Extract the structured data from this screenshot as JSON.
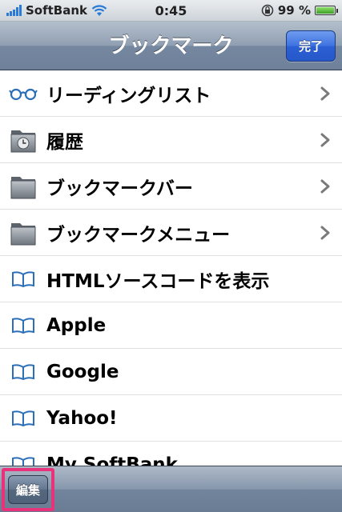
{
  "status_bar": {
    "carrier": "SoftBank",
    "time": "0:45",
    "battery_percent": "99 %",
    "battery_level": 0.99,
    "signal_icon": "signal-bars-icon",
    "wifi_icon": "wifi-icon",
    "lock_icon": "rotation-lock-icon"
  },
  "nav": {
    "title": "ブックマーク",
    "done_label": "完了"
  },
  "bookmarks": [
    {
      "label": "リーディングリスト",
      "icon": "glasses-icon",
      "has_chevron": true
    },
    {
      "label": "履歴",
      "icon": "history-folder-icon",
      "has_chevron": true
    },
    {
      "label": "ブックマークバー",
      "icon": "folder-icon",
      "has_chevron": true
    },
    {
      "label": "ブックマークメニュー",
      "icon": "folder-icon",
      "has_chevron": true
    },
    {
      "label": "HTMLソースコードを表示",
      "icon": "book-icon",
      "has_chevron": false
    },
    {
      "label": "Apple",
      "icon": "book-icon",
      "has_chevron": false
    },
    {
      "label": "Google",
      "icon": "book-icon",
      "has_chevron": false
    },
    {
      "label": "Yahoo!",
      "icon": "book-icon",
      "has_chevron": false
    },
    {
      "label": "My SoftBank",
      "icon": "book-icon",
      "has_chevron": false
    }
  ],
  "toolbar": {
    "edit_label": "編集"
  },
  "colors": {
    "nav_bar": "#7688a0",
    "done_button": "#3e72e0",
    "highlight": "#e8327a",
    "icon_blue": "#2a6fb8"
  }
}
